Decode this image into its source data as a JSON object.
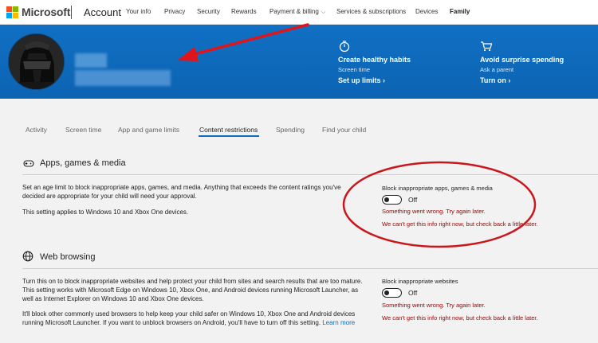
{
  "topnav": {
    "brand": "Microsoft",
    "account": "Account",
    "links": [
      "Your info",
      "Privacy",
      "Security",
      "Rewards",
      "Payment & billing",
      "Services & subscriptions",
      "Devices",
      "Family"
    ]
  },
  "banner": {
    "promo1": {
      "icon": "stopwatch-icon",
      "title": "Create healthy habits",
      "sub": "Screen time",
      "link": "Set up limits"
    },
    "promo2": {
      "icon": "cart-icon",
      "title": "Avoid surprise spending",
      "sub": "Ask a parent",
      "link": "Turn on"
    }
  },
  "tabs": [
    "Activity",
    "Screen time",
    "App and game limits",
    "Content restrictions",
    "Spending",
    "Find your child"
  ],
  "apps": {
    "title": "Apps, games & media",
    "desc1": "Set an age limit to block inappropriate apps, games, and media. Anything that exceeds the content ratings you've decided are appropriate for your child will need your approval.",
    "desc2": "This setting applies to Windows 10 and Xbox One devices.",
    "toggle_label": "Block inappropriate apps, games & media",
    "state": "Off",
    "error1": "Something went wrong. Try again later.",
    "error2": "We can't get this info right now, but check back a little later."
  },
  "web": {
    "title": "Web browsing",
    "desc1": "Turn this on to block inappropriate websites and help protect your child from sites and search results that are too mature. This setting works with Microsoft Edge on Windows 10, Xbox One, and Android devices running Microsoft Launcher, as well as Internet Explorer on Windows 10 and Xbox One devices.",
    "desc2": "It'll block other commonly used browsers to help keep your child safer on Windows 10, Xbox One and Android devices running Microsoft Launcher. If you want to unblock browsers on Android, you'll have to turn off this setting.",
    "learn_more": "Learn more",
    "toggle_label": "Block inappropriate websites",
    "state": "Off",
    "error1": "Something went wrong. Try again later.",
    "error2": "We can't get this info right now, but check back a little later."
  },
  "colors": {
    "accent": "#0f6cbd",
    "error": "#a80000",
    "annotation": "#e0151c"
  }
}
